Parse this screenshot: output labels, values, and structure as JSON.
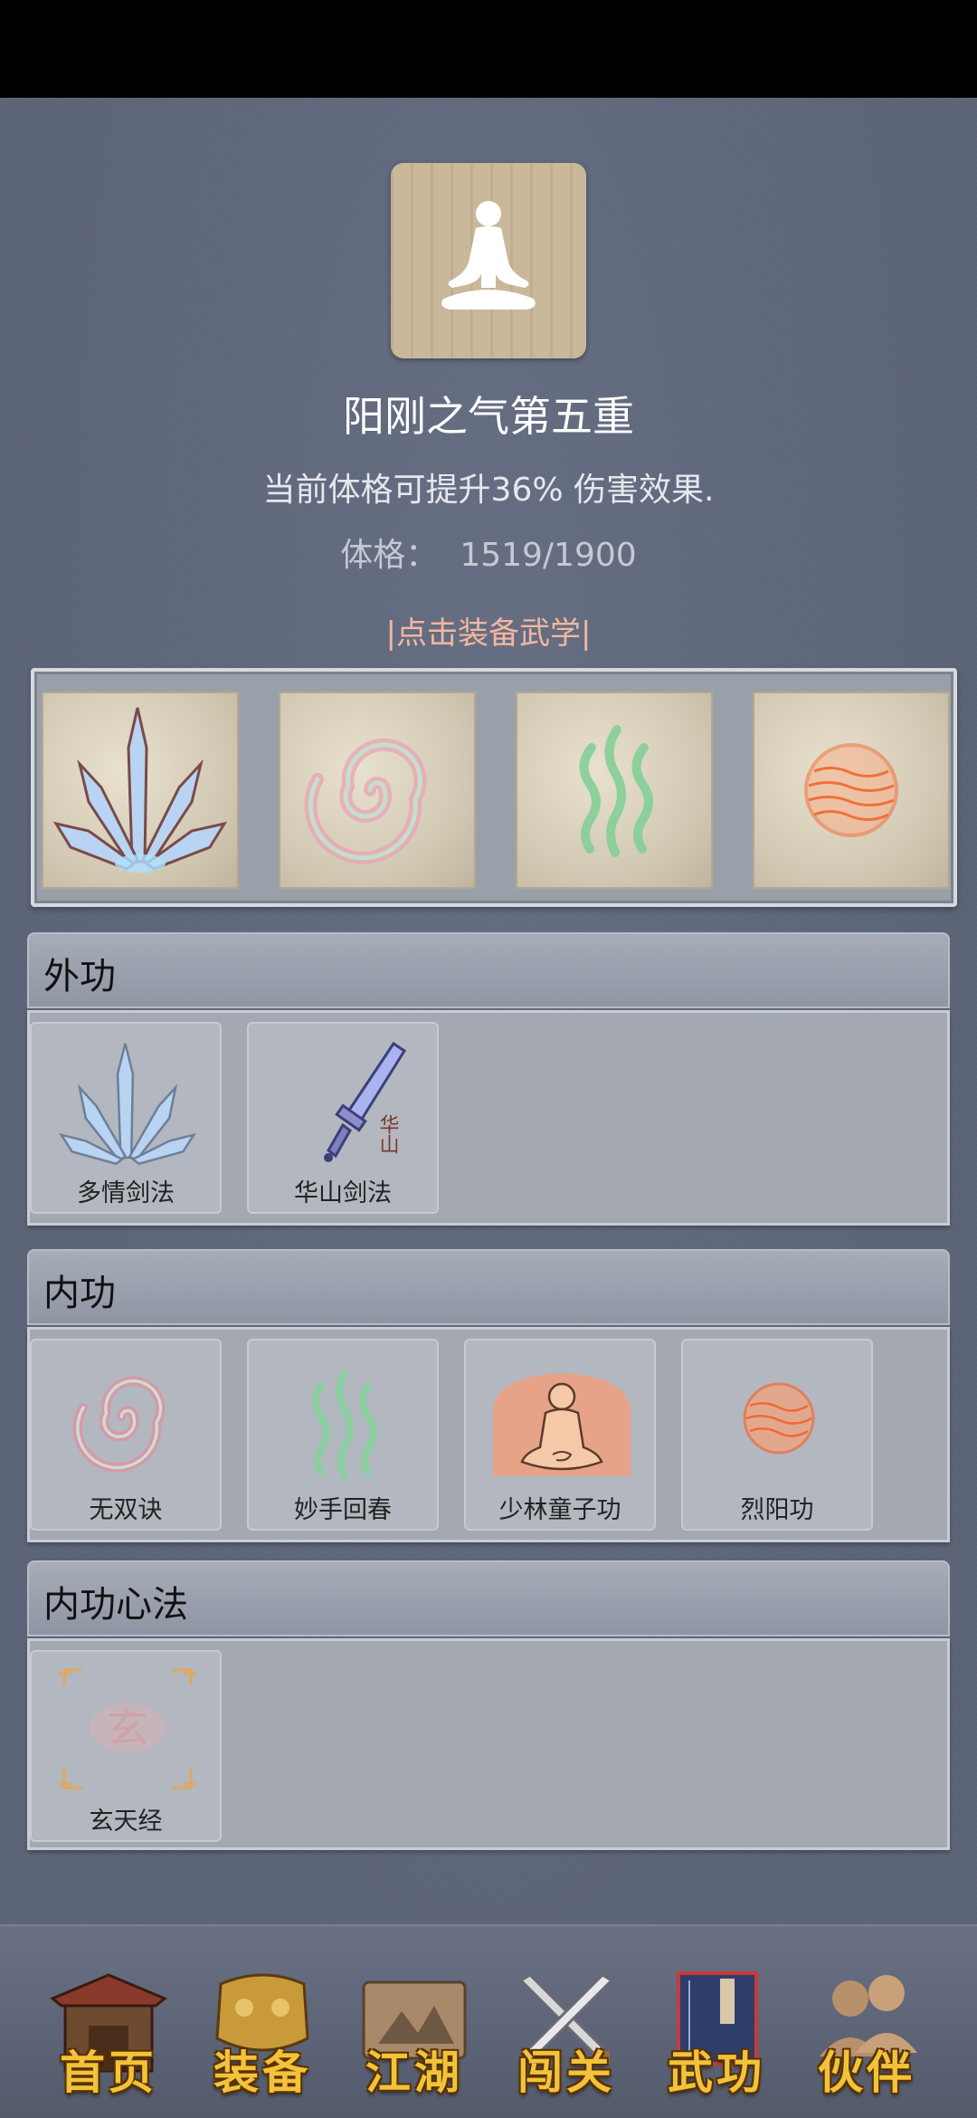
{
  "header": {
    "realm_title": "阳刚之气第五重",
    "effect_text": "当前体格可提升36% 伤害效果.",
    "stat_label": "体格：",
    "stat_value": "1519/1900",
    "equip_link": "|点击装备武学|"
  },
  "equipped_slots": [
    {
      "icon": "ice-blades-icon"
    },
    {
      "icon": "pink-spiral-icon"
    },
    {
      "icon": "green-waves-icon"
    },
    {
      "icon": "fire-orb-icon"
    }
  ],
  "sections": [
    {
      "title": "外功",
      "skills": [
        {
          "name": "多情剑法",
          "icon": "ice-blades-icon"
        },
        {
          "name": "华山剑法",
          "icon": "huashan-sword-icon"
        }
      ]
    },
    {
      "title": "内功",
      "skills": [
        {
          "name": "无双诀",
          "icon": "pink-spiral-icon"
        },
        {
          "name": "妙手回春",
          "icon": "green-waves-icon"
        },
        {
          "name": "少林童子功",
          "icon": "meditating-monk-icon"
        },
        {
          "name": "烈阳功",
          "icon": "fire-orb-icon"
        }
      ]
    },
    {
      "title": "内功心法",
      "skills": [
        {
          "name": "玄天经",
          "icon": "xuan-scroll-icon"
        }
      ]
    }
  ],
  "icon_text": {
    "huashan_glyph": "华山",
    "xuan_glyph": "玄"
  },
  "bottom_nav": [
    {
      "label": "首页",
      "icon": "pavilion-icon"
    },
    {
      "label": "装备",
      "icon": "armor-icon"
    },
    {
      "label": "江湖",
      "icon": "scroll-map-icon"
    },
    {
      "label": "闯关",
      "icon": "crossed-swords-icon"
    },
    {
      "label": "武功",
      "icon": "martial-book-icon"
    },
    {
      "label": "伙伴",
      "icon": "companions-icon"
    }
  ],
  "colors": {
    "background": "#5c6478",
    "equip_link": "#f3b7a0",
    "nav_label": "#f2c33a"
  }
}
